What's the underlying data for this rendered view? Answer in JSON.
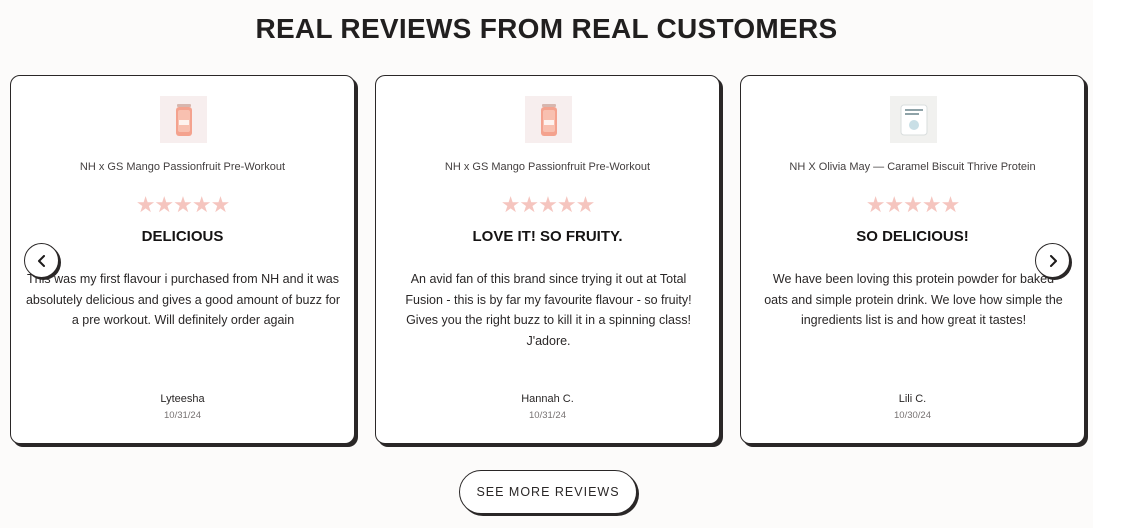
{
  "section": {
    "title": "REAL REVIEWS FROM REAL CUSTOMERS",
    "cta_label": "SEE MORE REVIEWS"
  },
  "carousel": {
    "prev_icon": "chevron-left-icon",
    "next_icon": "chevron-right-icon"
  },
  "reviews": [
    {
      "product": "NH x GS Mango Passionfruit Pre-Workout",
      "product_image": "pre-workout-can-thumbnail",
      "rating": 5,
      "stars": "★★★★★",
      "title": "DELICIOUS",
      "body": "This was my first flavour i purchased from NH and it was absolutely delicious and gives a good amount of buzz for a pre workout. Will definitely order again",
      "author": "Lyteesha",
      "date": "10/31/24"
    },
    {
      "product": "NH x GS Mango Passionfruit Pre-Workout",
      "product_image": "pre-workout-can-thumbnail",
      "rating": 5,
      "stars": "★★★★★",
      "title": "LOVE IT! SO FRUITY.",
      "body": "An avid fan of this brand since trying it out at Total Fusion - this is by far my favourite flavour - so fruity! Gives you the right buzz to kill it in a spinning class! J'adore.",
      "author": "Hannah C.",
      "date": "10/31/24"
    },
    {
      "product": "NH X Olivia May — Caramel Biscuit Thrive Protein",
      "product_image": "protein-pouch-thumbnail",
      "rating": 5,
      "stars": "★★★★★",
      "title": "SO DELICIOUS!",
      "body": "We have been loving this protein powder for baked oats and simple protein drink. We love how simple the ingredients list is and how great it tastes!",
      "author": "Lili C.",
      "date": "10/30/24"
    }
  ],
  "colors": {
    "star": "#f5c5bf",
    "outline": "#2a2727",
    "page_bg": "#fcfbfa"
  }
}
